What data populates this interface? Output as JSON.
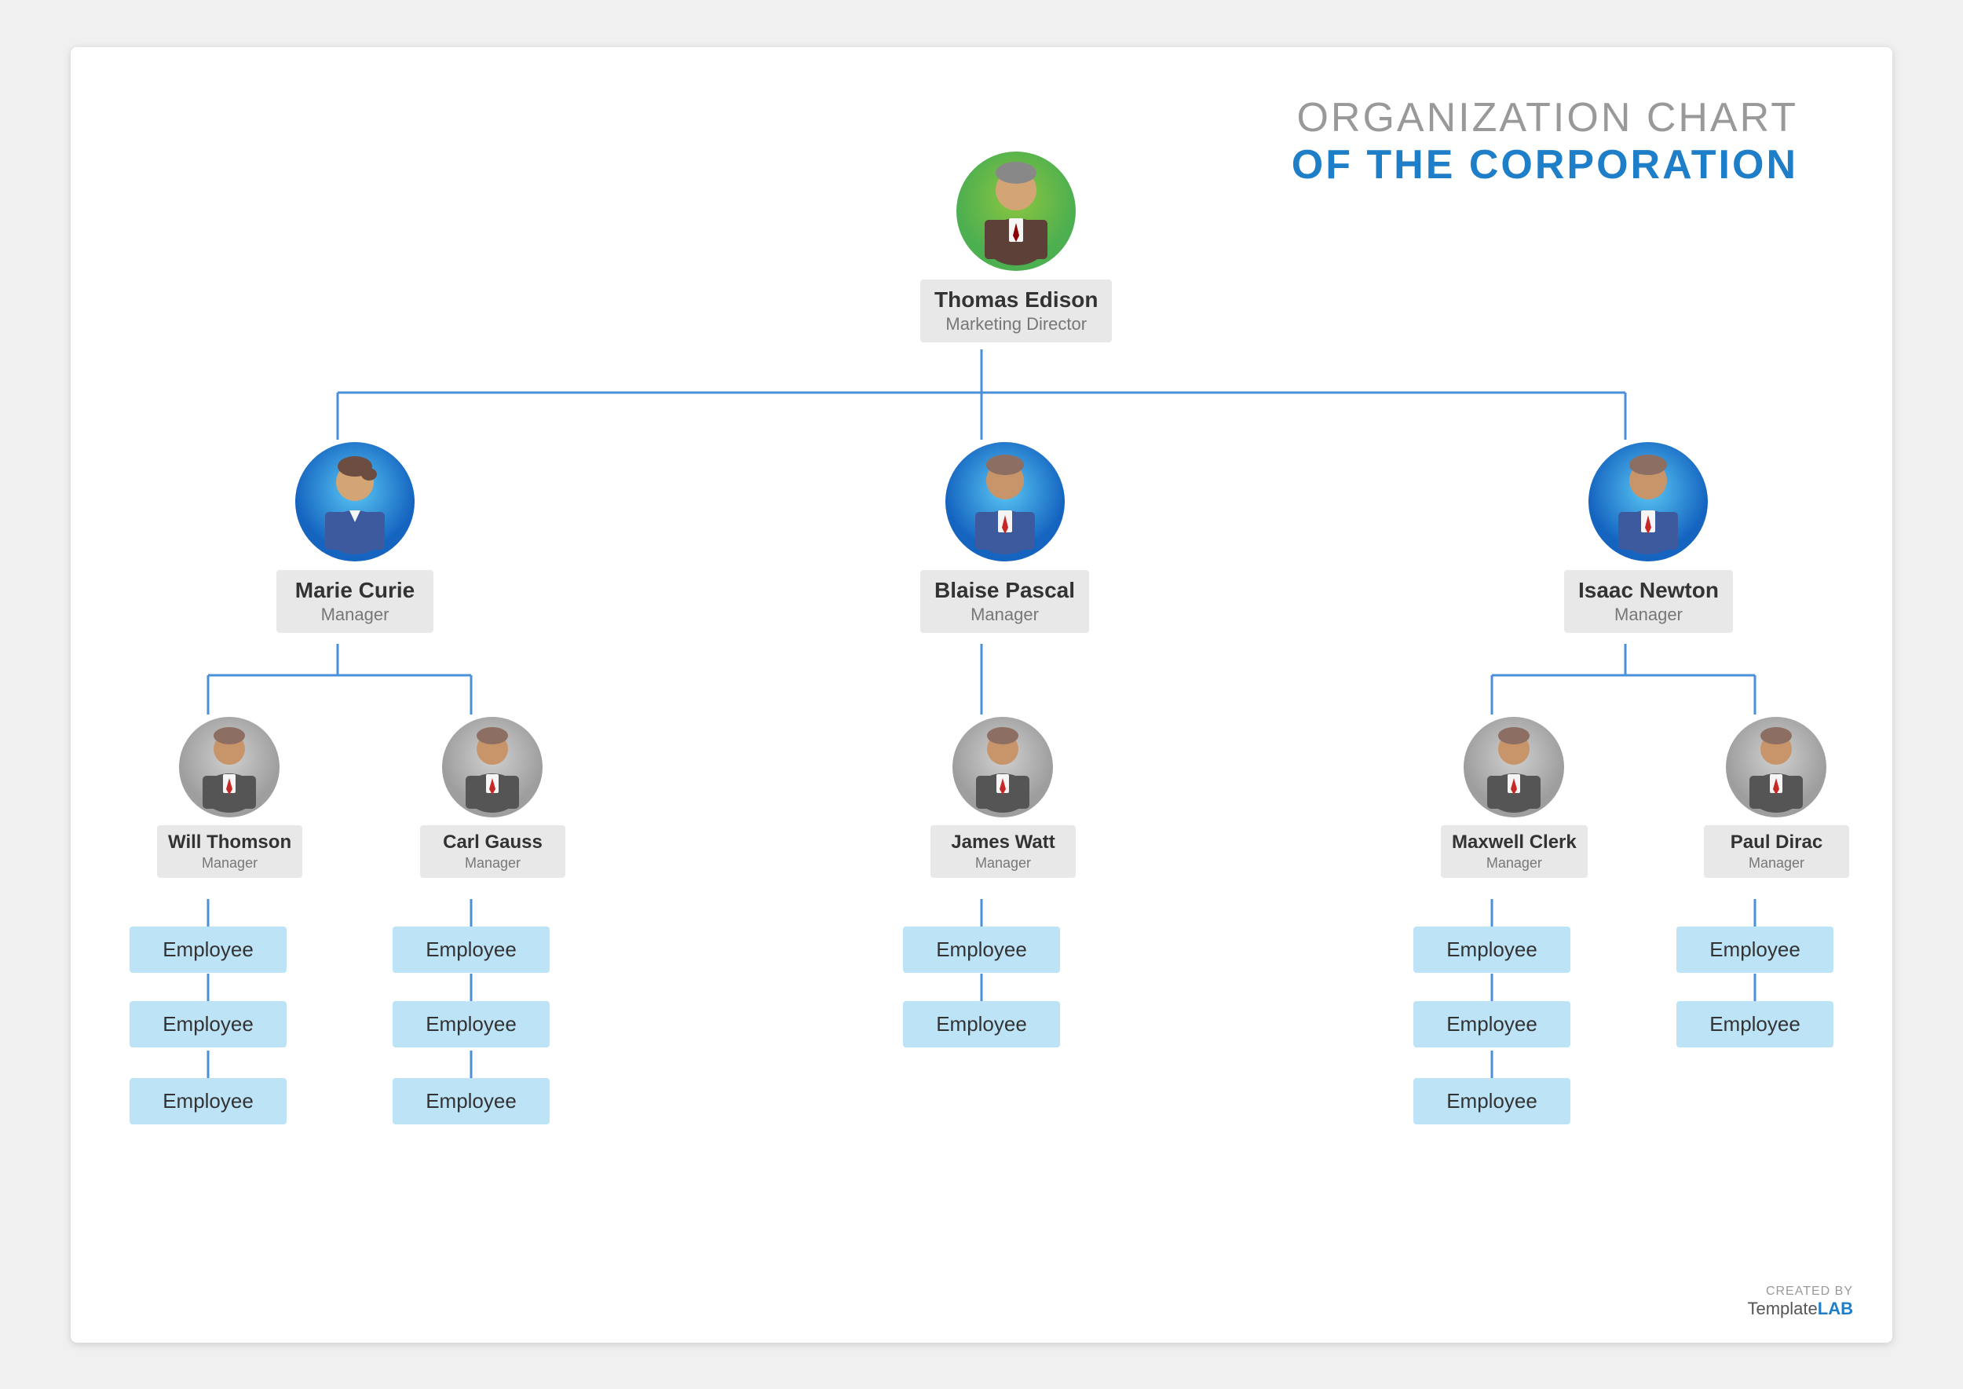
{
  "title": {
    "line1": "ORGANIZATION CHART",
    "line2": "OF THE CORPORATION"
  },
  "ceo": {
    "name": "Thomas Edison",
    "role": "Marketing Director"
  },
  "managers": [
    {
      "name": "Marie Curie",
      "role": "Manager",
      "gender": "female"
    },
    {
      "name": "Blaise Pascal",
      "role": "Manager",
      "gender": "male"
    },
    {
      "name": "Isaac Newton",
      "role": "Manager",
      "gender": "male"
    }
  ],
  "sub_managers": [
    {
      "name": "Will Thomson",
      "role": "Manager",
      "parent": 0
    },
    {
      "name": "Carl Gauss",
      "role": "Manager",
      "parent": 0
    },
    {
      "name": "James Watt",
      "role": "Manager",
      "parent": 1
    },
    {
      "name": "Maxwell Clerk",
      "role": "Manager",
      "parent": 2
    },
    {
      "name": "Paul Dirac",
      "role": "Manager",
      "parent": 2
    }
  ],
  "employees": {
    "will_thomson": [
      "Employee",
      "Employee",
      "Employee"
    ],
    "carl_gauss": [
      "Employee",
      "Employee",
      "Employee"
    ],
    "james_watt": [
      "Employee",
      "Employee"
    ],
    "maxwell_clerk": [
      "Employee",
      "Employee",
      "Employee"
    ],
    "paul_dirac": [
      "Employee",
      "Employee"
    ]
  },
  "brand": {
    "created_by": "CREATED BY",
    "template": "Template",
    "lab": "LAB"
  }
}
